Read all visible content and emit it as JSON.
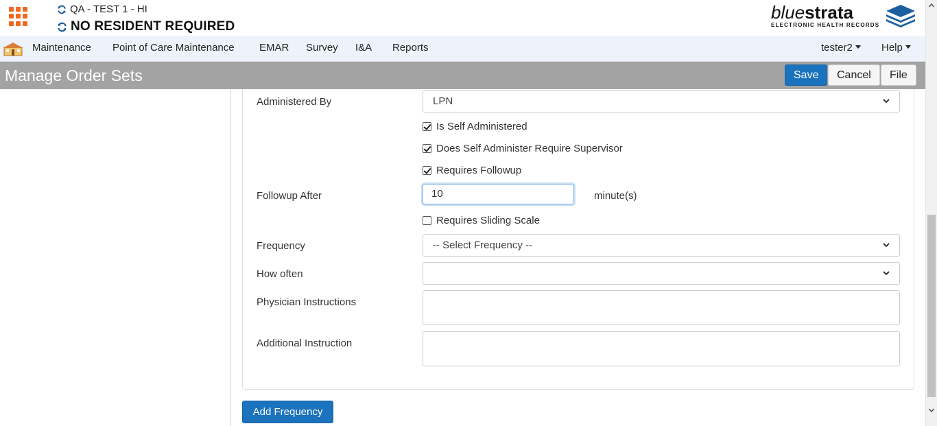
{
  "header": {
    "environment": "QA - TEST 1 - HI",
    "resident": "NO RESIDENT REQUIRED",
    "logo": {
      "name_light": "blue",
      "name_bold": "strata",
      "tagline": "ELECTRONIC HEALTH RECORDS"
    }
  },
  "nav": {
    "items": [
      "Maintenance",
      "Point of Care Maintenance",
      "EMAR",
      "Survey",
      "I&A",
      "Reports"
    ],
    "user": "tester2",
    "help": "Help"
  },
  "title_bar": {
    "title": "Manage Order Sets",
    "save_label": "Save",
    "cancel_label": "Cancel",
    "file_label": "File"
  },
  "form": {
    "administered_by": {
      "label": "Administered By",
      "value": "LPN"
    },
    "is_self_administered": {
      "label": "Is Self Administered",
      "checked": true
    },
    "self_requires_supervisor": {
      "label": "Does Self Administer Require Supervisor",
      "checked": true
    },
    "requires_followup": {
      "label": "Requires Followup",
      "checked": true
    },
    "followup_after": {
      "label": "Followup After",
      "value": "10",
      "unit": "minute(s)"
    },
    "requires_sliding_scale": {
      "label": "Requires Sliding Scale",
      "checked": false
    },
    "frequency": {
      "label": "Frequency",
      "value": "-- Select Frequency --"
    },
    "how_often": {
      "label": "How often",
      "value": ""
    },
    "physician_instructions": {
      "label": "Physician Instructions",
      "value": ""
    },
    "additional_instruction": {
      "label": "Additional Instruction",
      "value": ""
    }
  },
  "actions": {
    "add_frequency_label": "Add Frequency"
  },
  "colors": {
    "primary": "#1b72bd",
    "accent": "#f26a21",
    "title_bar": "#a3a3a3",
    "nav_bg": "#eef3fb"
  }
}
